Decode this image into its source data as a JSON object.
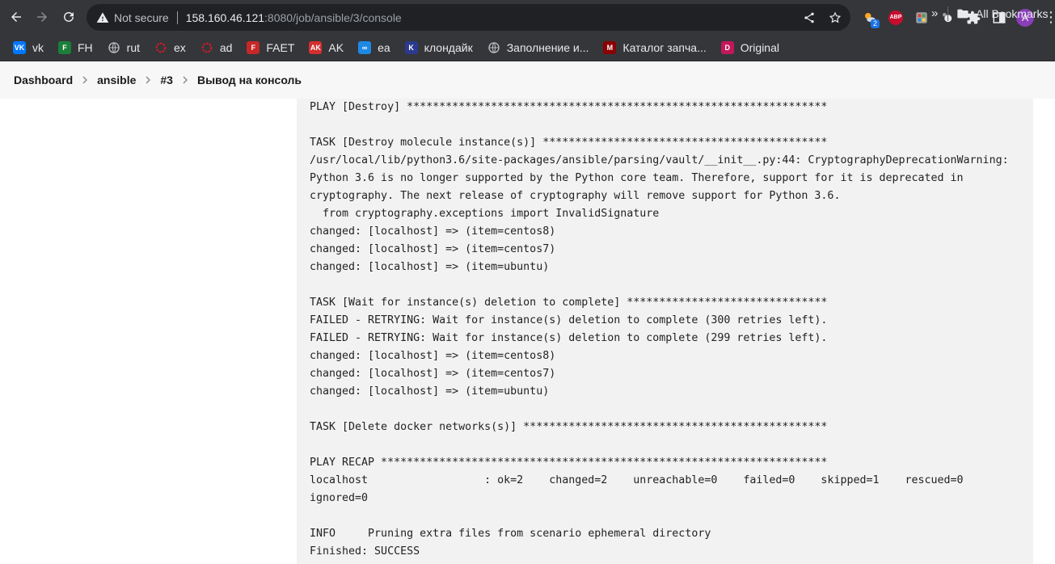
{
  "browser": {
    "security_label": "Not secure",
    "url_host": "158.160.46.121",
    "url_rest": ":8080/job/ansible/3/console",
    "weather_badge": "2",
    "abp_label": "ABP",
    "avatar_letter": "A"
  },
  "bookmarks": [
    {
      "label": "vk",
      "icon": "vk-icon",
      "color": "#0077ff",
      "glyph": "VK"
    },
    {
      "label": "FH",
      "icon": "fh-icon",
      "color": "#1b7f3a",
      "glyph": "F"
    },
    {
      "label": "rut",
      "icon": "globe-icon",
      "color": "",
      "glyph": ""
    },
    {
      "label": "ex",
      "icon": "ex-icon",
      "color": "#d11a2a",
      "glyph": ""
    },
    {
      "label": "ad",
      "icon": "ad-icon",
      "color": "#d11a2a",
      "glyph": ""
    },
    {
      "label": "FAET",
      "icon": "faet-icon",
      "color": "#c62828",
      "glyph": "F"
    },
    {
      "label": "AK",
      "icon": "ak-icon",
      "color": "#d32f2f",
      "glyph": "AK"
    },
    {
      "label": "ea",
      "icon": "ea-icon",
      "color": "#1e88e5",
      "glyph": "∞"
    },
    {
      "label": "клондайк",
      "icon": "klondike-icon",
      "color": "#2b3a8f",
      "glyph": "K"
    },
    {
      "label": "Заполнение и...",
      "icon": "globe-icon",
      "color": "",
      "glyph": ""
    },
    {
      "label": "Каталог запча...",
      "icon": "catalog-icon",
      "color": "#8b0000",
      "glyph": "M"
    },
    {
      "label": "Original",
      "icon": "original-icon",
      "color": "#c2185b",
      "glyph": "D"
    }
  ],
  "bookmarks_more": "»",
  "all_bookmarks": "All Bookmarks",
  "breadcrumb": [
    "Dashboard",
    "ansible",
    "#3",
    "Вывод на консоль"
  ],
  "console_lines": [
    "PLAY [Destroy] *****************************************************************",
    "",
    "TASK [Destroy molecule instance(s)] ********************************************",
    "/usr/local/lib/python3.6/site-packages/ansible/parsing/vault/__init__.py:44: CryptographyDeprecationWarning:",
    "Python 3.6 is no longer supported by the Python core team. Therefore, support for it is deprecated in",
    "cryptography. The next release of cryptography will remove support for Python 3.6.",
    "  from cryptography.exceptions import InvalidSignature",
    "changed: [localhost] => (item=centos8)",
    "changed: [localhost] => (item=centos7)",
    "changed: [localhost] => (item=ubuntu)",
    "",
    "TASK [Wait for instance(s) deletion to complete] *******************************",
    "FAILED - RETRYING: Wait for instance(s) deletion to complete (300 retries left).",
    "FAILED - RETRYING: Wait for instance(s) deletion to complete (299 retries left).",
    "changed: [localhost] => (item=centos8)",
    "changed: [localhost] => (item=centos7)",
    "changed: [localhost] => (item=ubuntu)",
    "",
    "TASK [Delete docker networks(s)] ***********************************************",
    "",
    "PLAY RECAP *********************************************************************",
    "localhost                  : ok=2    changed=2    unreachable=0    failed=0    skipped=1    rescued=0",
    "ignored=0",
    "",
    "INFO     Pruning extra files from scenario ephemeral directory",
    "Finished: SUCCESS"
  ]
}
